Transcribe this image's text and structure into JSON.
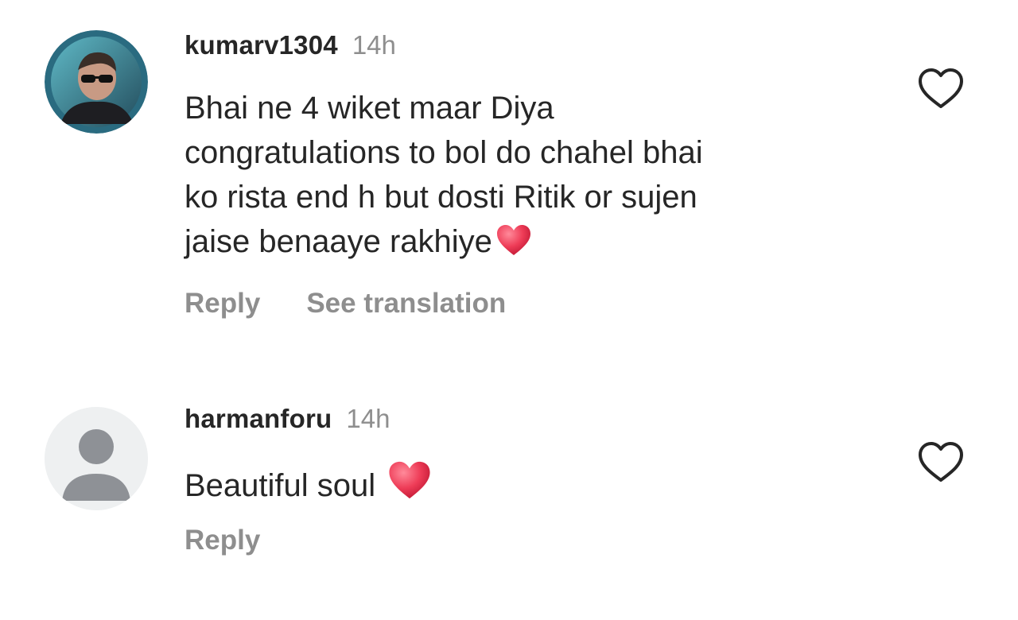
{
  "comments": [
    {
      "username": "kumarv1304",
      "time": "14h",
      "lines": [
        "Bhai ne 4 wiket maar Diya",
        "congratulations to bol do chahel bhai",
        "ko rista end h but dosti Ritik or sujen",
        "jaise benaaye rakhiye"
      ],
      "trailing_emoji": "red-heart",
      "avatar": "profile-photo",
      "actions": {
        "reply_label": "Reply",
        "translate_label": "See translation"
      },
      "like_icon": "heart-outline-icon"
    },
    {
      "username": "harmanforu",
      "time": "14h",
      "text": "Beautiful soul ",
      "trailing_emoji": "red-heart",
      "avatar": "default-avatar",
      "actions": {
        "reply_label": "Reply"
      },
      "like_icon": "heart-outline-icon"
    }
  ],
  "colors": {
    "primary_text": "#262626",
    "secondary_text": "#8e8e8e",
    "heart_emoji": "#e8344e",
    "placeholder_avatar_bg": "#eef0f1",
    "placeholder_avatar_fg": "#8e9196"
  }
}
